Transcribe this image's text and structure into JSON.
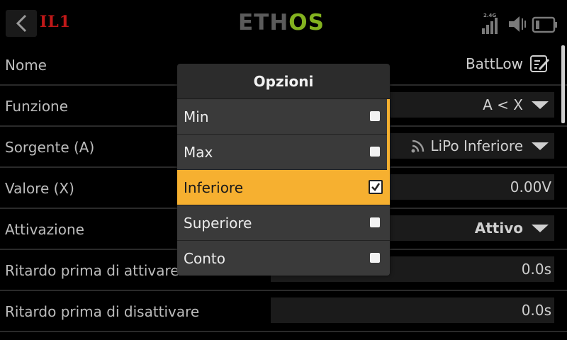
{
  "header": {
    "model_name": "IL1",
    "logo_left": "ETH",
    "logo_right": "OS",
    "signal_label": "2.4G"
  },
  "rows": [
    {
      "label": "Nome",
      "value": "BattLow"
    },
    {
      "label": "Funzione",
      "value": "A < X"
    },
    {
      "label": "Sorgente (A)",
      "value": "LiPo Inferiore"
    },
    {
      "label": "Valore (X)",
      "value": "0.00V"
    },
    {
      "label": "Attivazione",
      "value": "Attivo"
    },
    {
      "label": "Ritardo prima di attivare",
      "value": "0.0s"
    },
    {
      "label": "Ritardo prima di disattivare",
      "value": "0.0s"
    }
  ],
  "dialog": {
    "title": "Opzioni",
    "options": [
      {
        "label": "Min",
        "checked": false
      },
      {
        "label": "Max",
        "checked": false
      },
      {
        "label": "Inferiore",
        "checked": true
      },
      {
        "label": "Superiore",
        "checked": false
      },
      {
        "label": "Conto",
        "checked": false
      }
    ]
  },
  "colors": {
    "accent": "#f6b030",
    "logo_green": "#83b21f",
    "model_red": "#c01818"
  }
}
